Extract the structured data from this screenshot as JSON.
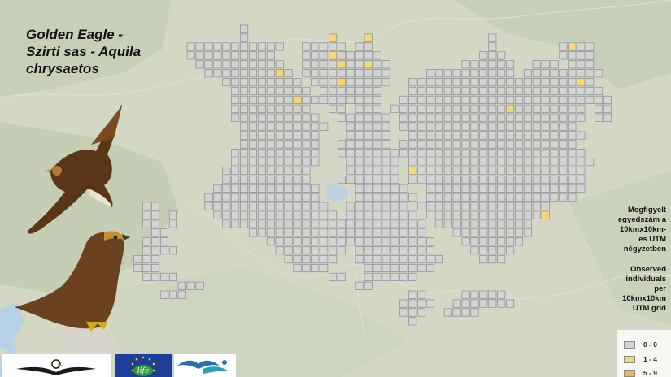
{
  "title": {
    "line1": "Golden Eagle -",
    "line2": "Szirti sas - Aquila",
    "line3": "chrysaetos"
  },
  "legend_hu": [
    "Megfigyelt",
    "egyedszám a",
    "10kmx10km-",
    "es UTM",
    "négyzetben"
  ],
  "legend_en": [
    "Observed",
    "individuals",
    "per",
    "10kmx10km",
    "UTM grid"
  ],
  "legend": {
    "classes": [
      {
        "label": "0 - 0",
        "color": "#d3d3d3"
      },
      {
        "label": "1 - 4",
        "color": "#f6d774"
      },
      {
        "label": "5 - 9",
        "color": "#efb559"
      }
    ]
  },
  "colors": {
    "cell_zero": "#d3d3d3",
    "cell_low": "#f6d774",
    "cell_border": "#8c8c8c",
    "basemap": "#cfd6c2",
    "water": "#b7d2e6"
  },
  "grid": {
    "columns": 48,
    "rows": 34,
    "highlight_class": "1 - 4"
  },
  "icons": [
    "golden-eagle-flying-illustration",
    "golden-eagle-perched-illustration",
    "eagle-logo",
    "eu-life-logo",
    "bird-organization-logo"
  ]
}
